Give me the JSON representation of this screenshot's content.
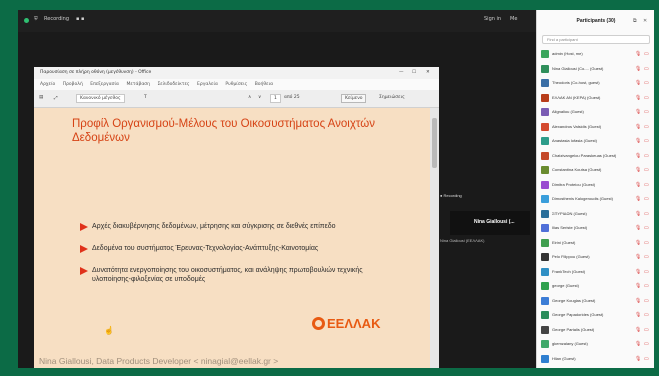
{
  "topbar": {
    "left_label": "Recording",
    "right_items": [
      "Sign in",
      "Me"
    ],
    "status_color": "#2fbf71"
  },
  "share": {
    "window_title": "Παρουσίαση σε πλήρη οθόνη (μεγέθυνση) - Office",
    "menu_items": [
      "Αρχείο",
      "Προβολή",
      "Επεξεργασία",
      "Μετάβαση",
      "Σελιδοδείκτες",
      "Εργαλεία",
      "Ρυθμίσεις",
      "Βοήθεια"
    ],
    "toolbar": {
      "zoom": "Κανονικό μέγεθος",
      "page_value": "1",
      "page_total": "από 25",
      "mode_button": "Κείμενο",
      "annotate_button": "Σημειώσεις"
    }
  },
  "slide": {
    "title": "Προφίλ Οργανισμού-Μέλους του Οικοσυστήματος Ανοιχτών Δεδομένων",
    "bullets": [
      "Αρχές διακυβέρνησης δεδομένων, μέτρησης και σύγκρισης σε διεθνές επίπεδο",
      "Δεδομένα του συστήματος Έρευνας-Τεχνολογίας-Ανάπτυξης-Καινοτομίας",
      "Δυνατότητα ενεργοποίησης του οικοσυστήματος, και ανάληψης πρωτοβουλιών τεχνικής υλοποίησης-φιλοξενίας σε υποδομές"
    ],
    "logo": "ΕΕΛΛΑΚ",
    "footer": "Nina Giallousi, Data Products Developer < ninagial@eellak.gr >",
    "accent": "#d64315"
  },
  "speaker": {
    "name": "Nina Giallousi (...",
    "caption": "Nina Giallousi (ΕΕΛΛΑΚ)",
    "tag": "Recording"
  },
  "panel": {
    "title": "Participants (30)",
    "search_placeholder": "Find a participant",
    "participants": [
      {
        "name": "admin (Host, me)",
        "color": "#3ba55c"
      },
      {
        "name": "Nina Giallousi (Co-... (Guest)",
        "color": "#2f8f5b"
      },
      {
        "name": "Theodoris (Co-host, guest)",
        "color": "#3a6ea5"
      },
      {
        "name": "ΕΛΛΑΚ ΑΝ (ΚΕΡΑ) (Guest)",
        "color": "#b83d1a"
      },
      {
        "name": "Alignaliou (Guest)",
        "color": "#7a5cb3"
      },
      {
        "name": "Alexandros Valsidis (Guest)",
        "color": "#d44a2f"
      },
      {
        "name": "Anastasia Iofasia (Guest)",
        "color": "#2d9c8a"
      },
      {
        "name": "Chatzivangelou Paraskeuas (Guest)",
        "color": "#c4492a"
      },
      {
        "name": "Constantina Koutsa (Guest)",
        "color": "#6a8c2f"
      },
      {
        "name": "Dimitra Proteiou (Guest)",
        "color": "#9a4bd0"
      },
      {
        "name": "Dimosthenis Kalogeroudis (Guest)",
        "color": "#3a9edb"
      },
      {
        "name": "ΣΠΥΡΙΔΩΝ (Guest)",
        "color": "#2a6e9a"
      },
      {
        "name": "Ilias Seriste (Guest)",
        "color": "#4f6fd8"
      },
      {
        "name": "Eirini (Guest)",
        "color": "#3f9e4f"
      },
      {
        "name": "Pelo Filippou (Guest)",
        "color": "#333333"
      },
      {
        "name": "FrankTech (Guest)",
        "color": "#2f8fc4"
      },
      {
        "name": "george (Guest)",
        "color": "#30a14e"
      },
      {
        "name": "George Kouglas (Guest)",
        "color": "#3c7dd6"
      },
      {
        "name": "George Papadorides (Guest)",
        "color": "#2a8c5a"
      },
      {
        "name": "George Partalis (Guest)",
        "color": "#444444"
      },
      {
        "name": "gkemzalany (Guest)",
        "color": "#3fa86a"
      },
      {
        "name": "Hlian (Guest)",
        "color": "#2f7fd0"
      }
    ]
  }
}
